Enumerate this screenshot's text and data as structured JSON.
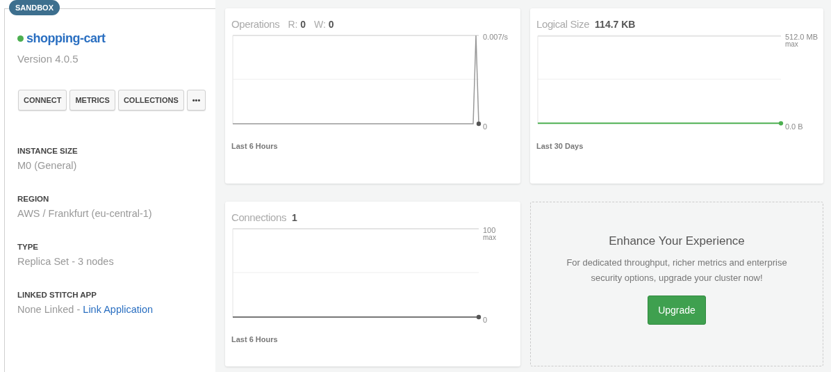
{
  "badge": "SANDBOX",
  "cluster": {
    "name": "shopping-cart",
    "color": "#4caf50",
    "version": "Version 4.0.5"
  },
  "buttons": [
    "CONNECT",
    "METRICS",
    "COLLECTIONS",
    "•••"
  ],
  "details": [
    {
      "label": "INSTANCE SIZE",
      "value": "M0 (General)"
    },
    {
      "label": "REGION",
      "value": "AWS / Frankfurt (eu-central-1)"
    },
    {
      "label": "TYPE",
      "value": "Replica Set - 3 nodes"
    },
    {
      "label": "LINKED STITCH APP",
      "value": "None Linked - ",
      "link": "Link Application"
    }
  ],
  "metrics": [
    {
      "kind": "spike",
      "title": "Operations",
      "readings": [
        {
          "label": "R:",
          "value": "0"
        },
        {
          "label": "W:",
          "value": "0"
        }
      ],
      "top_label": "0.007/s",
      "bottom_label": "0",
      "period": "Last 6 Hours"
    },
    {
      "kind": "flat-green",
      "title": "Logical Size",
      "readings": [
        {
          "value": "114.7 KB"
        }
      ],
      "top_label": "512.0 MB",
      "top_sub": "max",
      "bottom_label": "0.0 B",
      "period": "Last 30 Days"
    },
    {
      "kind": "flat",
      "title": "Connections",
      "readings": [
        {
          "value": "1"
        }
      ],
      "top_label": "100",
      "top_sub": "max",
      "bottom_label": "0",
      "period": "Last 6 Hours"
    }
  ],
  "upsell": {
    "title": "Enhance Your Experience",
    "text": "For dedicated throughput, richer metrics and enterprise security options, upgrade your cluster now!",
    "button": "Upgrade"
  }
}
